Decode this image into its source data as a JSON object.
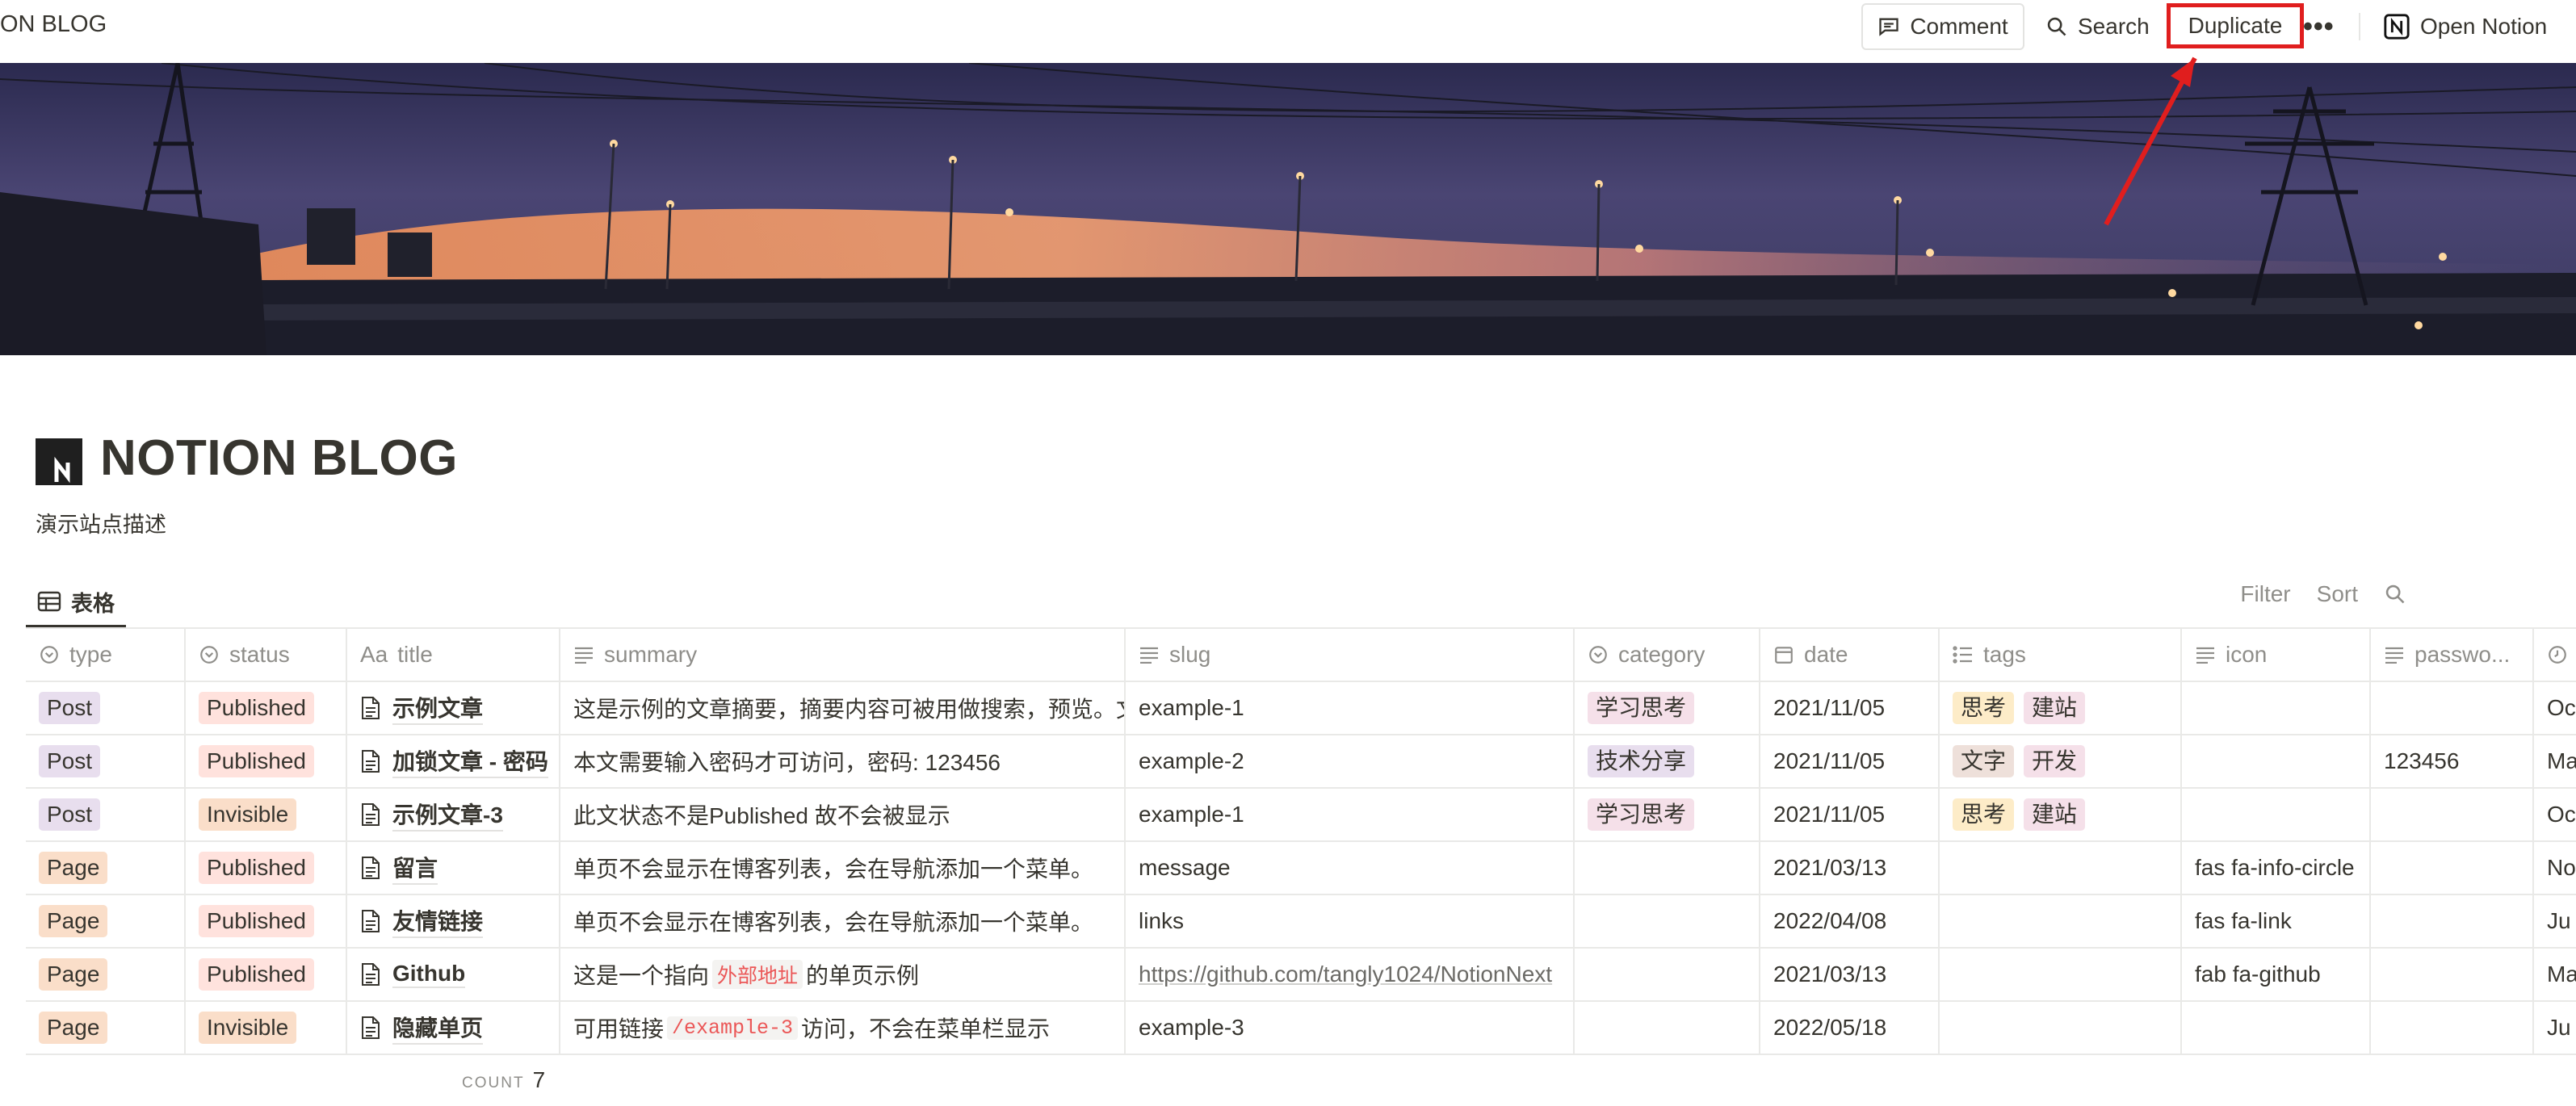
{
  "topbar": {
    "crumb": "ON BLOG",
    "comment_label": "Comment",
    "search_label": "Search",
    "duplicate_label": "Duplicate",
    "more_label": "•••",
    "open_notion_label": "Open Notion"
  },
  "page": {
    "title": "NOTION BLOG",
    "description": "演示站点描述"
  },
  "view": {
    "tab_label": "表格",
    "filter_label": "Filter",
    "sort_label": "Sort"
  },
  "table": {
    "columns": {
      "type": "type",
      "status": "status",
      "title_prefix": "Aa",
      "title": "title",
      "summary": "summary",
      "slug": "slug",
      "category": "category",
      "date": "date",
      "tags": "tags",
      "icon": "icon",
      "password": "passwo..."
    },
    "rows": [
      {
        "type": "Post",
        "status": "Published",
        "title": "示例文章",
        "summary": "这是示例的文章摘要，摘要内容可被用做搜索，预览。文",
        "slug": "example-1",
        "category": "学习思考",
        "date": "2021/11/05",
        "tags": [
          "思考",
          "建站"
        ],
        "icon": "",
        "password": "",
        "extra": "Oc"
      },
      {
        "type": "Post",
        "status": "Published",
        "title": "加锁文章 - 密码",
        "summary": "本文需要输入密码才可访问，密码: 123456",
        "slug": "example-2",
        "category": "技术分享",
        "date": "2021/11/05",
        "tags": [
          "文字",
          "开发"
        ],
        "icon": "",
        "password": "123456",
        "extra": "Ma"
      },
      {
        "type": "Post",
        "status": "Invisible",
        "title": "示例文章-3",
        "summary": "此文状态不是Published 故不会被显示",
        "slug": "example-1",
        "category": "学习思考",
        "date": "2021/11/05",
        "tags": [
          "思考",
          "建站"
        ],
        "icon": "",
        "password": "",
        "extra": "Oc"
      },
      {
        "type": "Page",
        "status": "Published",
        "title": "留言",
        "summary": "单页不会显示在博客列表，会在导航添加一个菜单。",
        "slug": "message",
        "category": "",
        "date": "2021/03/13",
        "tags": [],
        "icon": "fas fa-info-circle",
        "password": "",
        "extra": "No"
      },
      {
        "type": "Page",
        "status": "Published",
        "title": "友情链接",
        "summary": "单页不会显示在博客列表，会在导航添加一个菜单。",
        "slug": "links",
        "category": "",
        "date": "2022/04/08",
        "tags": [],
        "icon": "fas fa-link",
        "password": "",
        "extra": "Ju"
      },
      {
        "type": "Page",
        "status": "Published",
        "title": "Github",
        "summary_pre": "这是一个指向",
        "summary_code": "外部地址",
        "summary_post": "的单页示例",
        "slug": "https://github.com/tangly1024/NotionNext",
        "category": "",
        "date": "2021/03/13",
        "tags": [],
        "icon": "fab fa-github",
        "password": "",
        "extra": "Ma"
      },
      {
        "type": "Page",
        "status": "Invisible",
        "title": "隐藏单页",
        "summary_pre": "可用链接",
        "summary_code": "/example-3",
        "summary_post": "访问，不会在菜单栏显示",
        "slug": "example-3",
        "category": "",
        "date": "2022/05/18",
        "tags": [],
        "icon": "",
        "password": "",
        "extra": "Ju"
      }
    ],
    "count_label": "COUNT",
    "count_value": "7"
  },
  "colors": {
    "text": "#37352f",
    "muted": "#8f8e8a",
    "highlight": "#e01e1e",
    "tag_post": "#e8deee",
    "tag_page": "#fadec9",
    "tag_published": "#ffe2dd",
    "tag_invisible": "#fadec9",
    "tag_category": "#f5e0e9",
    "tag_think": "#fdecc8",
    "tag_build": "#f5e0e9",
    "tag_text": "#eee0da",
    "tag_dev": "#f5e0e9"
  }
}
